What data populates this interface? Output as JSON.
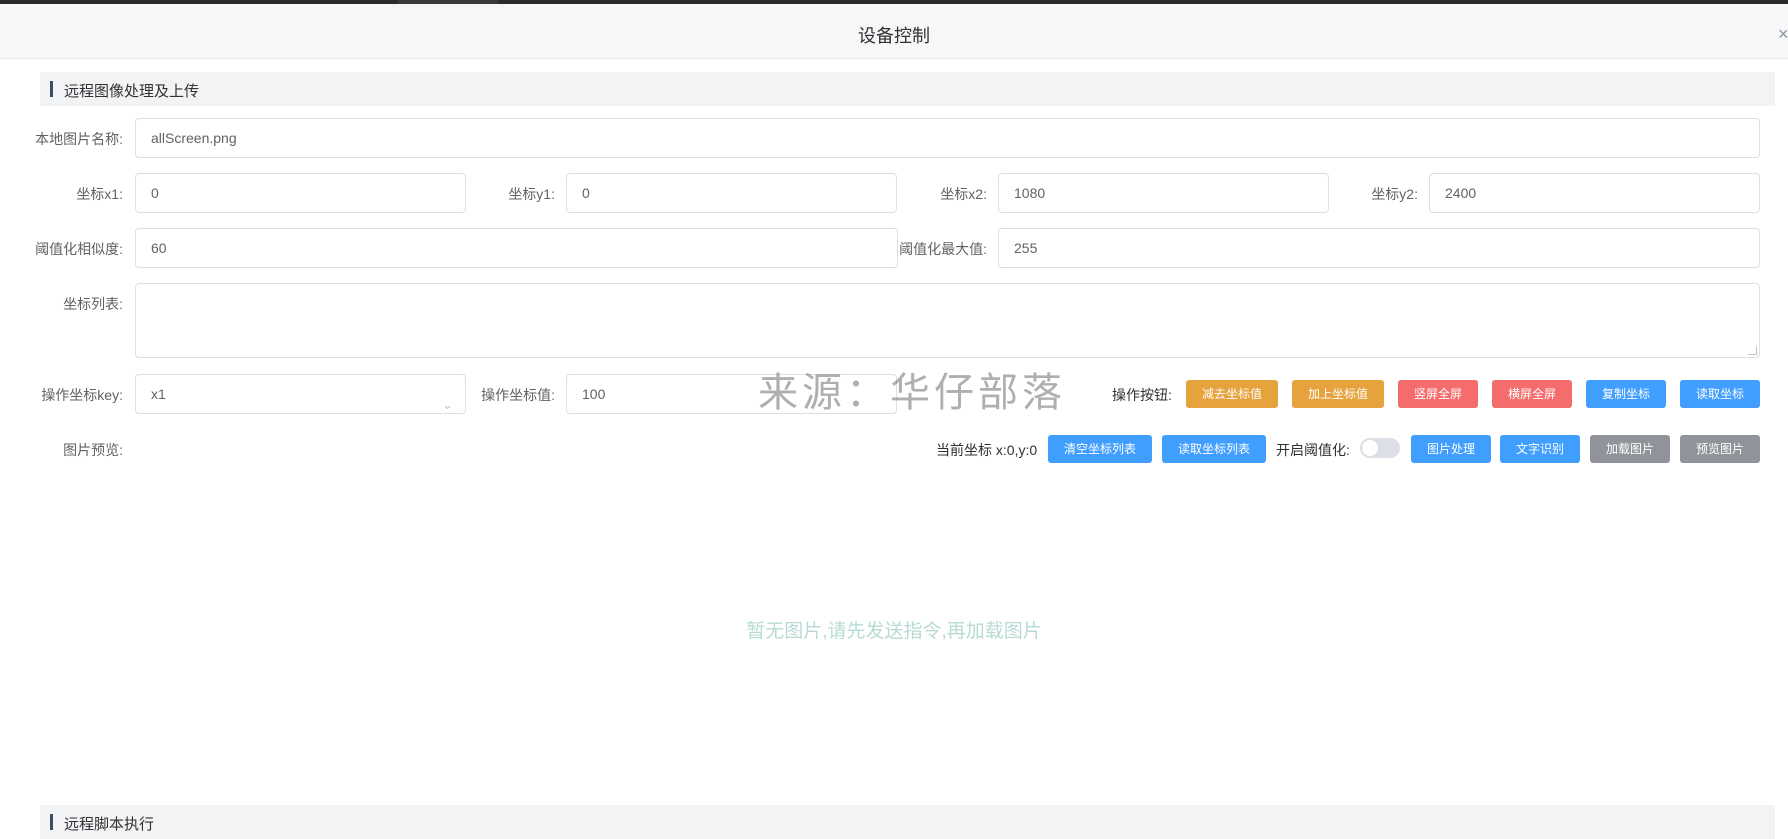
{
  "dialog": {
    "title": "设备控制",
    "close_glyph": "×"
  },
  "section1": {
    "title": "远程图像处理及上传"
  },
  "section2": {
    "title": "远程脚本执行"
  },
  "form": {
    "local_image_name": {
      "label": "本地图片名称:",
      "value": "allScreen.png"
    },
    "x1": {
      "label": "坐标x1:",
      "value": "0"
    },
    "y1": {
      "label": "坐标y1:",
      "value": "0"
    },
    "x2": {
      "label": "坐标x2:",
      "value": "1080"
    },
    "y2": {
      "label": "坐标y2:",
      "value": "2400"
    },
    "threshold_similarity": {
      "label": "阈值化相似度:",
      "value": "60"
    },
    "threshold_max": {
      "label": "阈值化最大值:",
      "value": "255"
    },
    "coord_list": {
      "label": "坐标列表:",
      "value": ""
    },
    "op_key": {
      "label": "操作坐标key:",
      "value": "x1"
    },
    "op_value": {
      "label": "操作坐标值:",
      "value": "100"
    },
    "op_buttons_label": "操作按钮:",
    "preview_label": "图片预览:"
  },
  "buttons": {
    "subtract": "减去坐标值",
    "add": "加上坐标值",
    "portrait": "竖屏全屏",
    "landscape": "横屏全屏",
    "copy": "复制坐标",
    "read": "读取坐标",
    "clear_list": "清空坐标列表",
    "read_list": "读取坐标列表",
    "process": "图片处理",
    "ocr": "文字识别",
    "load": "加载图片",
    "preview": "预览图片"
  },
  "status": {
    "current_coord": "当前坐标 x:0,y:0",
    "threshold_toggle_label": "开启阈值化:",
    "threshold_enabled": false,
    "empty_message": "暂无图片,请先发送指令,再加载图片"
  },
  "watermark": "来源：华仔部落",
  "colors": {
    "warning": "#e6a23c",
    "danger": "#f56c6c",
    "primary": "#409eff",
    "info": "#909399"
  }
}
